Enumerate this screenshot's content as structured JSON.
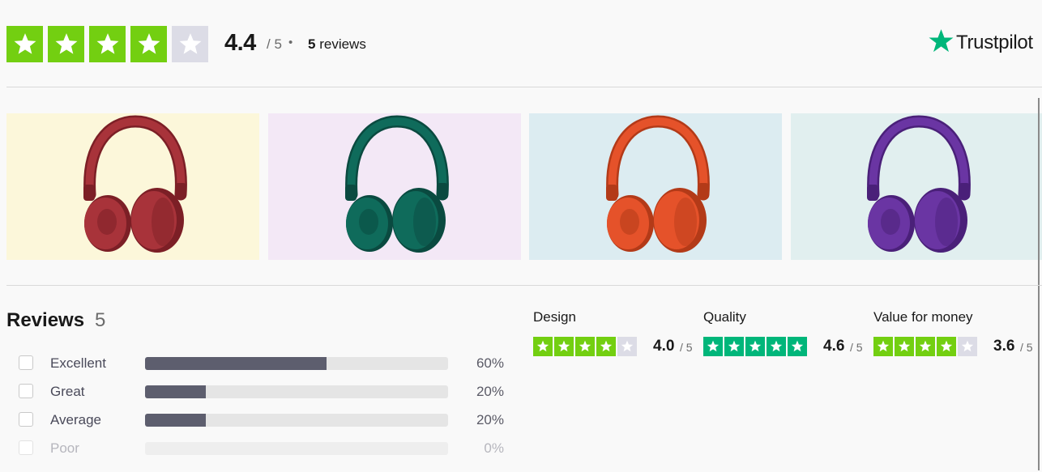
{
  "summary": {
    "rating": "4.4",
    "rating_max": "/ 5",
    "separator": "•",
    "review_count": "5",
    "review_word": "reviews",
    "stars_filled": 4,
    "stars_total": 5
  },
  "brand": {
    "name": "Trustpilot",
    "icon": "star-icon",
    "color": "#00b67a"
  },
  "colors": {
    "star_green": "#73cf11",
    "star_empty": "#dcdce6",
    "tp_green": "#00b67a",
    "bar_fill": "#5d5e6e"
  },
  "gallery": [
    {
      "name": "red headphones",
      "bg": "#fcf7da",
      "color": "#a8333a",
      "dark": "#7c1f26"
    },
    {
      "name": "teal headphones",
      "bg": "#f3e8f6",
      "color": "#0f6b5b",
      "dark": "#0a4a40"
    },
    {
      "name": "orange headphones",
      "bg": "#dcecf1",
      "color": "#e5522a",
      "dark": "#b33a18"
    },
    {
      "name": "purple headphones",
      "bg": "#e1efef",
      "color": "#6a35a3",
      "dark": "#4a2079"
    }
  ],
  "reviews": {
    "title": "Reviews",
    "count": "5",
    "distribution": [
      {
        "label": "Excellent",
        "percent_text": "60%",
        "fraction": 0.6,
        "muted": false
      },
      {
        "label": "Great",
        "percent_text": "20%",
        "fraction": 0.2,
        "muted": false
      },
      {
        "label": "Average",
        "percent_text": "20%",
        "fraction": 0.2,
        "muted": false
      },
      {
        "label": "Poor",
        "percent_text": "0%",
        "fraction": 0,
        "muted": true
      }
    ]
  },
  "sub_ratings": [
    {
      "title": "Design",
      "value": "4.0",
      "max": "/ 5",
      "stars_filled": 4,
      "star_color": "#73cf11"
    },
    {
      "title": "Quality",
      "value": "4.6",
      "max": "/ 5",
      "stars_filled": 5,
      "star_color": "#00b67a"
    },
    {
      "title": "Value for money",
      "value": "3.6",
      "max": "/ 5",
      "stars_filled": 4,
      "star_color": "#73cf11"
    }
  ]
}
